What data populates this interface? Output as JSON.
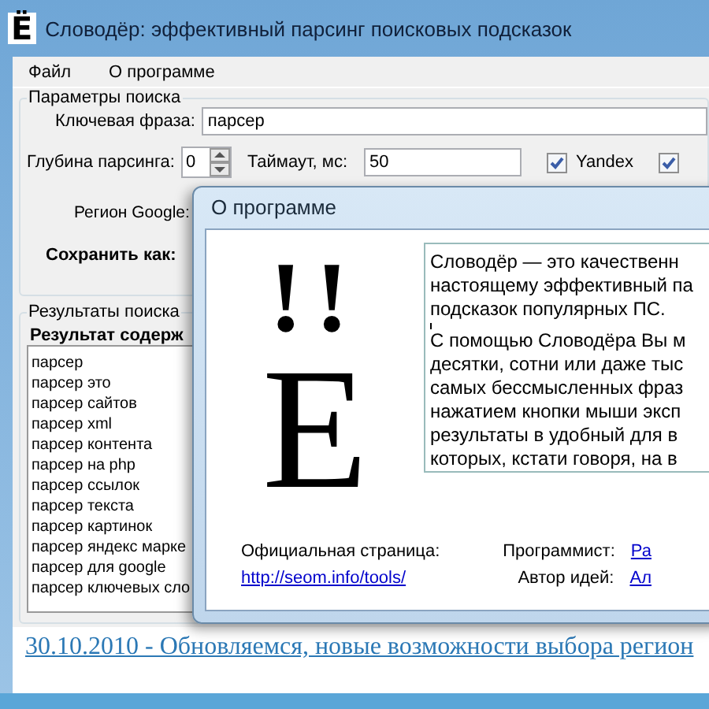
{
  "window": {
    "icon": "Ё",
    "title": "Словодёр: эффективный парсинг поисковых подсказок"
  },
  "menu": [
    "Файл",
    "О программе"
  ],
  "search_params": {
    "title": "Параметры поиска",
    "keyword_label": "Ключевая фраза:",
    "keyword_value": "парсер",
    "depth_label": "Глубина парсинга:",
    "depth_value": "0",
    "timeout_label": "Таймаут, мс:",
    "timeout_value": "50",
    "engines": [
      {
        "label": "Yandex",
        "checked": true
      },
      {
        "checked": true
      }
    ],
    "region_label": "Регион Google:",
    "save_label": "Сохранить как:"
  },
  "results": {
    "title": "Результаты поиска",
    "header": "Результат содерж",
    "items": [
      "парсер",
      "парсер это",
      "парсер сайтов",
      "парсер xml",
      "парсер контента",
      "парсер на php",
      "парсер ссылок",
      "парсер текста",
      "парсер картинок",
      "парсер яндекс марке",
      "парсер для google",
      "парсер ключевых сло"
    ]
  },
  "news_link": "30.10.2010 - Обновляемся, новые возможности выбора регион",
  "about_dialog": {
    "title": "О программе",
    "logo": {
      "marks": "!!",
      "letter": "Е"
    },
    "description": [
      [
        "Словодёр — это качественн",
        "настоящему эффективный па",
        "подсказок популярных ПС."
      ],
      [
        "С помощью Словодёра Вы м",
        "десятки, сотни или даже тыс",
        "самых бессмысленных фраз",
        "нажатием кнопки мыши эксп",
        "результаты в удобный для в",
        "которых, кстати говоря, на в"
      ]
    ],
    "site_label": "Официальная страница:",
    "site_link": "http://seom.info/tools/",
    "credits": [
      {
        "label": "Программист:",
        "value": "Ра"
      },
      {
        "label": "Автор идей:",
        "value": "Ал"
      }
    ]
  }
}
